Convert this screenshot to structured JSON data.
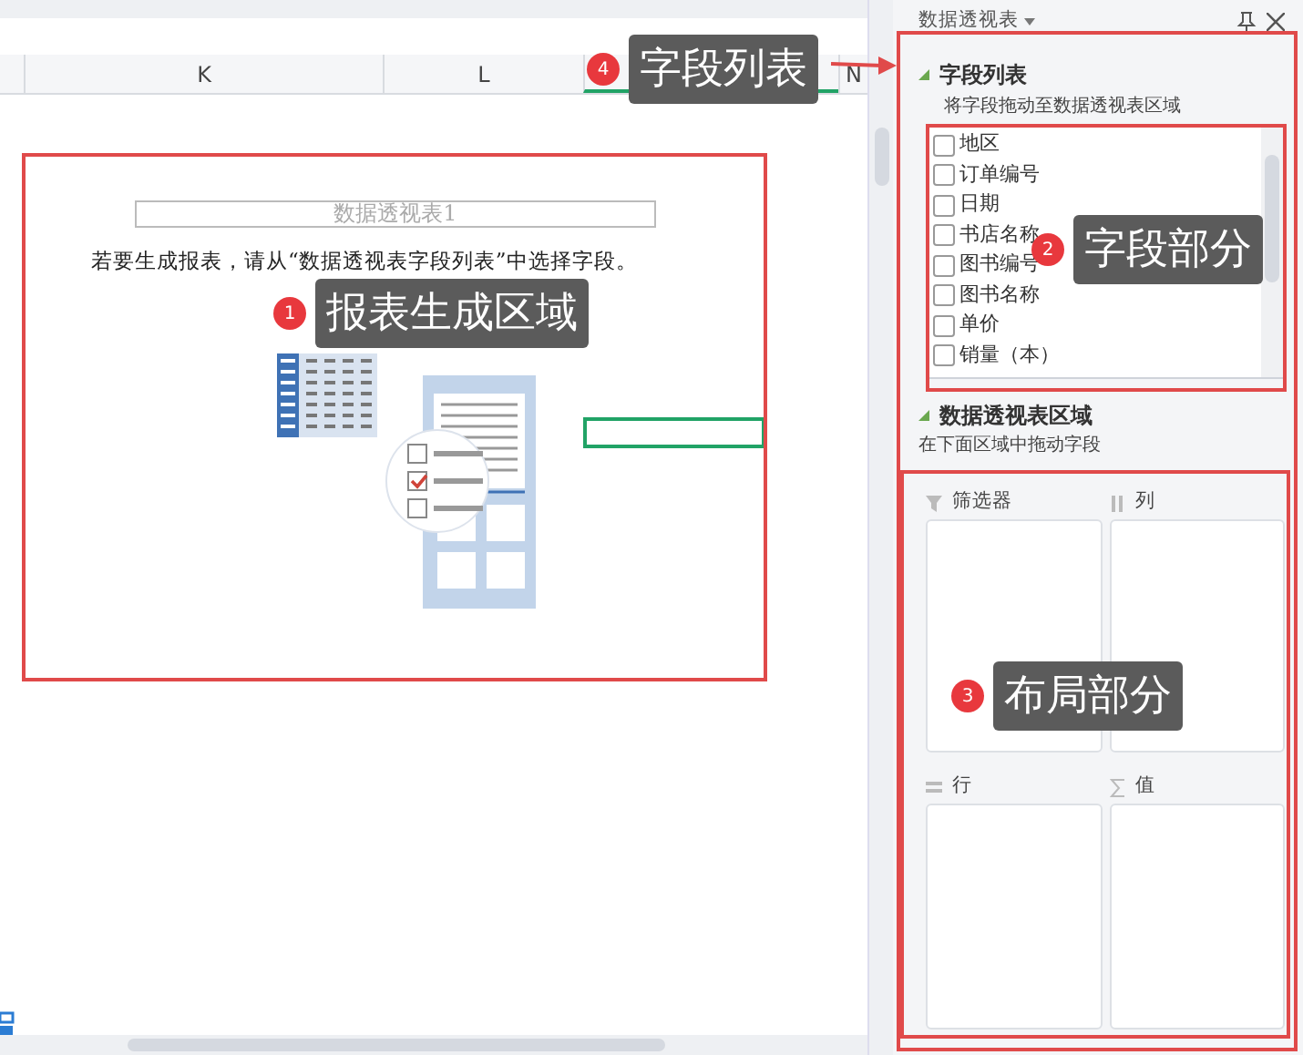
{
  "sheet": {
    "columns": [
      {
        "label": "K",
        "selected": false
      },
      {
        "label": "L",
        "selected": false
      },
      {
        "selected": true
      },
      {
        "label": "N",
        "selected": false
      }
    ],
    "pivot_placeholder": {
      "title": "数据透视表1",
      "instruction": "若要生成报表，请从“数据透视表字段列表”中选择字段。"
    }
  },
  "panel": {
    "title": "数据透视表",
    "field_section": {
      "heading": "字段列表",
      "expanded": true,
      "hint": "将字段拖动至数据透视表区域"
    },
    "fields": [
      {
        "label": "地区",
        "checked": false
      },
      {
        "label": "订单编号",
        "checked": false
      },
      {
        "label": "日期",
        "checked": false
      },
      {
        "label": "书店名称",
        "checked": false
      },
      {
        "label": "图书编号",
        "checked": false
      },
      {
        "label": "图书名称",
        "checked": false
      },
      {
        "label": "单价",
        "checked": false
      },
      {
        "label": "销量（本）",
        "checked": false
      }
    ],
    "area_section": {
      "heading": "数据透视表区域",
      "expanded": true,
      "hint": "在下面区域中拖动字段"
    },
    "areas": [
      {
        "label": "筛选器",
        "kind": "filter"
      },
      {
        "label": "列",
        "kind": "columns"
      },
      {
        "label": "行",
        "kind": "rows"
      },
      {
        "label": "值",
        "kind": "values"
      }
    ]
  },
  "annotations": [
    {
      "number": "4",
      "label": "字段列表",
      "kind": "panel"
    },
    {
      "number": "2",
      "label": "字段部分",
      "kind": "fields"
    },
    {
      "number": "1",
      "label": "报表生成区域",
      "kind": "report"
    },
    {
      "number": "3",
      "label": "布局部分",
      "kind": "layout"
    }
  ]
}
